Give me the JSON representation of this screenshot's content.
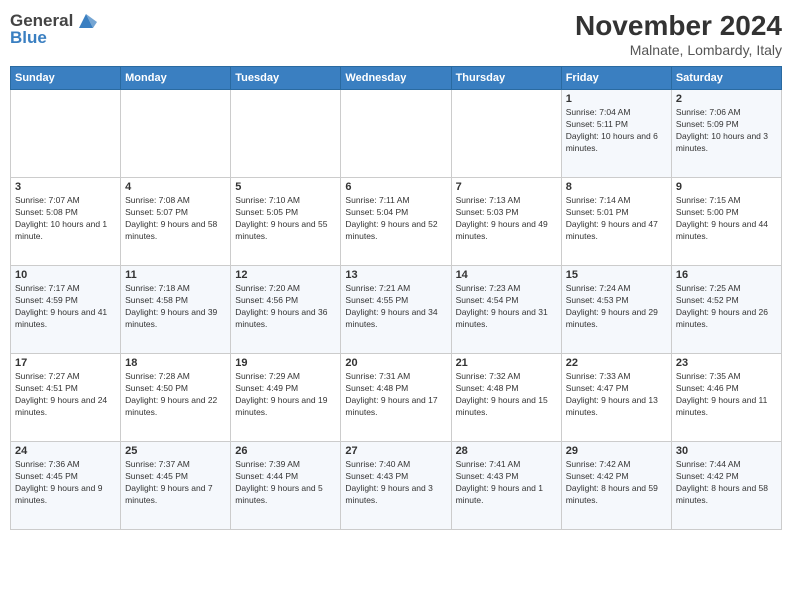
{
  "header": {
    "logo_general": "General",
    "logo_blue": "Blue",
    "month_title": "November 2024",
    "subtitle": "Malnate, Lombardy, Italy"
  },
  "days_of_week": [
    "Sunday",
    "Monday",
    "Tuesday",
    "Wednesday",
    "Thursday",
    "Friday",
    "Saturday"
  ],
  "weeks": [
    [
      {
        "day": "",
        "info": ""
      },
      {
        "day": "",
        "info": ""
      },
      {
        "day": "",
        "info": ""
      },
      {
        "day": "",
        "info": ""
      },
      {
        "day": "",
        "info": ""
      },
      {
        "day": "1",
        "info": "Sunrise: 7:04 AM\nSunset: 5:11 PM\nDaylight: 10 hours and 6 minutes."
      },
      {
        "day": "2",
        "info": "Sunrise: 7:06 AM\nSunset: 5:09 PM\nDaylight: 10 hours and 3 minutes."
      }
    ],
    [
      {
        "day": "3",
        "info": "Sunrise: 7:07 AM\nSunset: 5:08 PM\nDaylight: 10 hours and 1 minute."
      },
      {
        "day": "4",
        "info": "Sunrise: 7:08 AM\nSunset: 5:07 PM\nDaylight: 9 hours and 58 minutes."
      },
      {
        "day": "5",
        "info": "Sunrise: 7:10 AM\nSunset: 5:05 PM\nDaylight: 9 hours and 55 minutes."
      },
      {
        "day": "6",
        "info": "Sunrise: 7:11 AM\nSunset: 5:04 PM\nDaylight: 9 hours and 52 minutes."
      },
      {
        "day": "7",
        "info": "Sunrise: 7:13 AM\nSunset: 5:03 PM\nDaylight: 9 hours and 49 minutes."
      },
      {
        "day": "8",
        "info": "Sunrise: 7:14 AM\nSunset: 5:01 PM\nDaylight: 9 hours and 47 minutes."
      },
      {
        "day": "9",
        "info": "Sunrise: 7:15 AM\nSunset: 5:00 PM\nDaylight: 9 hours and 44 minutes."
      }
    ],
    [
      {
        "day": "10",
        "info": "Sunrise: 7:17 AM\nSunset: 4:59 PM\nDaylight: 9 hours and 41 minutes."
      },
      {
        "day": "11",
        "info": "Sunrise: 7:18 AM\nSunset: 4:58 PM\nDaylight: 9 hours and 39 minutes."
      },
      {
        "day": "12",
        "info": "Sunrise: 7:20 AM\nSunset: 4:56 PM\nDaylight: 9 hours and 36 minutes."
      },
      {
        "day": "13",
        "info": "Sunrise: 7:21 AM\nSunset: 4:55 PM\nDaylight: 9 hours and 34 minutes."
      },
      {
        "day": "14",
        "info": "Sunrise: 7:23 AM\nSunset: 4:54 PM\nDaylight: 9 hours and 31 minutes."
      },
      {
        "day": "15",
        "info": "Sunrise: 7:24 AM\nSunset: 4:53 PM\nDaylight: 9 hours and 29 minutes."
      },
      {
        "day": "16",
        "info": "Sunrise: 7:25 AM\nSunset: 4:52 PM\nDaylight: 9 hours and 26 minutes."
      }
    ],
    [
      {
        "day": "17",
        "info": "Sunrise: 7:27 AM\nSunset: 4:51 PM\nDaylight: 9 hours and 24 minutes."
      },
      {
        "day": "18",
        "info": "Sunrise: 7:28 AM\nSunset: 4:50 PM\nDaylight: 9 hours and 22 minutes."
      },
      {
        "day": "19",
        "info": "Sunrise: 7:29 AM\nSunset: 4:49 PM\nDaylight: 9 hours and 19 minutes."
      },
      {
        "day": "20",
        "info": "Sunrise: 7:31 AM\nSunset: 4:48 PM\nDaylight: 9 hours and 17 minutes."
      },
      {
        "day": "21",
        "info": "Sunrise: 7:32 AM\nSunset: 4:48 PM\nDaylight: 9 hours and 15 minutes."
      },
      {
        "day": "22",
        "info": "Sunrise: 7:33 AM\nSunset: 4:47 PM\nDaylight: 9 hours and 13 minutes."
      },
      {
        "day": "23",
        "info": "Sunrise: 7:35 AM\nSunset: 4:46 PM\nDaylight: 9 hours and 11 minutes."
      }
    ],
    [
      {
        "day": "24",
        "info": "Sunrise: 7:36 AM\nSunset: 4:45 PM\nDaylight: 9 hours and 9 minutes."
      },
      {
        "day": "25",
        "info": "Sunrise: 7:37 AM\nSunset: 4:45 PM\nDaylight: 9 hours and 7 minutes."
      },
      {
        "day": "26",
        "info": "Sunrise: 7:39 AM\nSunset: 4:44 PM\nDaylight: 9 hours and 5 minutes."
      },
      {
        "day": "27",
        "info": "Sunrise: 7:40 AM\nSunset: 4:43 PM\nDaylight: 9 hours and 3 minutes."
      },
      {
        "day": "28",
        "info": "Sunrise: 7:41 AM\nSunset: 4:43 PM\nDaylight: 9 hours and 1 minute."
      },
      {
        "day": "29",
        "info": "Sunrise: 7:42 AM\nSunset: 4:42 PM\nDaylight: 8 hours and 59 minutes."
      },
      {
        "day": "30",
        "info": "Sunrise: 7:44 AM\nSunset: 4:42 PM\nDaylight: 8 hours and 58 minutes."
      }
    ]
  ]
}
